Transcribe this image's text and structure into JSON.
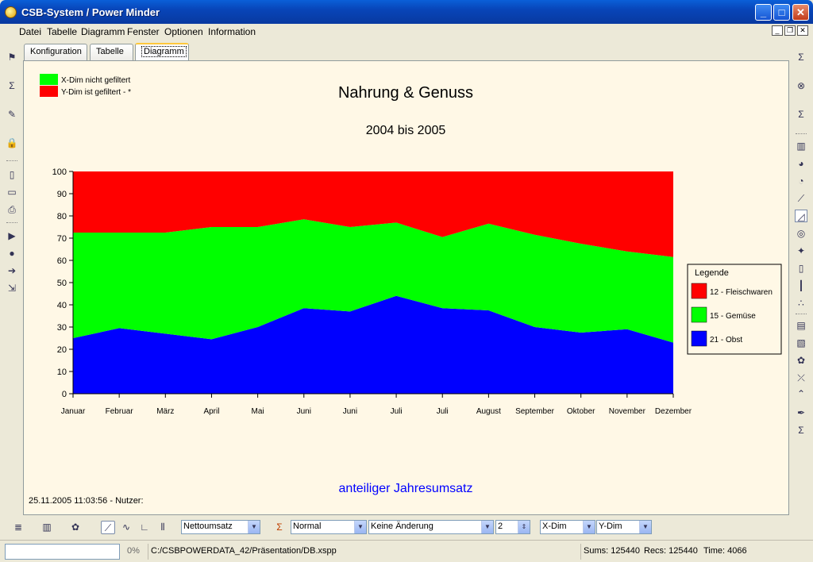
{
  "window": {
    "title": "CSB-System / Power Minder"
  },
  "menu": [
    "Datei",
    "Tabelle",
    "Diagramm",
    "Fenster",
    "Optionen",
    "Information"
  ],
  "tabs": [
    "Konfiguration",
    "Tabelle",
    "Diagramm"
  ],
  "active_tab": "Diagramm",
  "filter_legend": [
    {
      "label": "X-Dim nicht gefiltert",
      "color": "#00ff00"
    },
    {
      "label": "Y-Dim ist gefiltert - *",
      "color": "#ff0000"
    }
  ],
  "chart_data": {
    "type": "area",
    "stacked": true,
    "percent": true,
    "title": "Nahrung & Genuss",
    "subtitle": "2004 bis 2005",
    "footer_title": "anteiliger Jahresumsatz",
    "categories": [
      "Januar",
      "Februar",
      "März",
      "April",
      "Mai",
      "Juni",
      "Juni",
      "Juli",
      "Juli",
      "August",
      "September",
      "Oktober",
      "November",
      "Dezember"
    ],
    "series": [
      {
        "name": "21 - Obst",
        "color": "#0000ff",
        "values": [
          25,
          29.5,
          27,
          24.5,
          30,
          38.5,
          37,
          44,
          38.5,
          37.5,
          30,
          27.5,
          29,
          23
        ]
      },
      {
        "name": "15 - Gemüse",
        "color": "#00ff00",
        "values": [
          47.5,
          43,
          45.5,
          50.5,
          45,
          40,
          38,
          33,
          32,
          39,
          41.5,
          40,
          35,
          38.5
        ]
      },
      {
        "name": "12 - Fleischwaren",
        "color": "#ff0000",
        "values": [
          27.5,
          27.5,
          27.5,
          25,
          25,
          21.5,
          25,
          23,
          29.5,
          23.5,
          28.5,
          32.5,
          36,
          38.5
        ]
      }
    ],
    "ylim": [
      0,
      100
    ],
    "yticks": [
      0,
      10,
      20,
      30,
      40,
      50,
      60,
      70,
      80,
      90,
      100
    ],
    "legend_title": "Legende",
    "legend_items": [
      {
        "name": "12 - Fleischwaren",
        "color": "#ff0000"
      },
      {
        "name": "15 - Gemüse",
        "color": "#00ff00"
      },
      {
        "name": "21 - Obst",
        "color": "#0000ff"
      }
    ],
    "grid": false,
    "legend_position": "right"
  },
  "footer": {
    "timestamp": "25.11.2005 11:03:56 - Nutzer:"
  },
  "bottom_toolbar": {
    "measure": "Nettoumsatz",
    "mode": "Normal",
    "change": "Keine Änderung",
    "decimals": "2",
    "xdim": "X-Dim",
    "ydim": "Y-Dim"
  },
  "statusbar": {
    "progress": "0%",
    "path": "C:/CSBPOWERDATA_42/Präsentation/DB.xspp",
    "sums": "Sums: 125440",
    "recs": "Recs: 125440",
    "time": "Time: 4066"
  }
}
